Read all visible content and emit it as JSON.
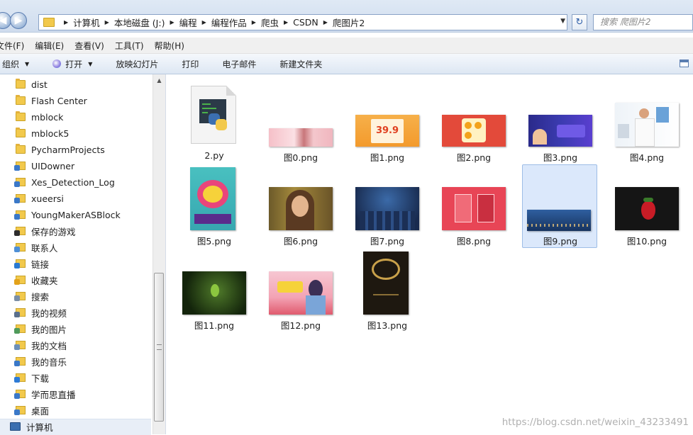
{
  "addressbar": {
    "breadcrumbs": [
      "计算机",
      "本地磁盘 (J:)",
      "编程",
      "编程作品",
      "爬虫",
      "CSDN",
      "爬图片2"
    ],
    "search_placeholder": "搜索 爬图片2"
  },
  "menubar": {
    "items": [
      "文件(F)",
      "编辑(E)",
      "查看(V)",
      "工具(T)",
      "帮助(H)"
    ]
  },
  "toolbar": {
    "organize": "组织",
    "open": "打开",
    "slideshow": "放映幻灯片",
    "print": "打印",
    "email": "电子邮件",
    "new_folder": "新建文件夹"
  },
  "navpane": {
    "items": [
      {
        "label": "dist",
        "icon": "folder-icon"
      },
      {
        "label": "Flash Center",
        "icon": "folder-icon"
      },
      {
        "label": "mblock",
        "icon": "folder-icon"
      },
      {
        "label": "mblock5",
        "icon": "folder-icon"
      },
      {
        "label": "PycharmProjects",
        "icon": "folder-icon"
      },
      {
        "label": "UIDowner",
        "icon": "special-folder-icon"
      },
      {
        "label": "Xes_Detection_Log",
        "icon": "special-folder-icon"
      },
      {
        "label": "xueersi",
        "icon": "special-folder-icon"
      },
      {
        "label": "YoungMakerASBlock",
        "icon": "special-folder-icon"
      },
      {
        "label": "保存的游戏",
        "icon": "saved-games-icon"
      },
      {
        "label": "联系人",
        "icon": "contacts-icon"
      },
      {
        "label": "链接",
        "icon": "links-icon"
      },
      {
        "label": "收藏夹",
        "icon": "favorites-icon"
      },
      {
        "label": "搜索",
        "icon": "searches-icon"
      },
      {
        "label": "我的视频",
        "icon": "videos-icon"
      },
      {
        "label": "我的图片",
        "icon": "pictures-icon"
      },
      {
        "label": "我的文档",
        "icon": "documents-icon"
      },
      {
        "label": "我的音乐",
        "icon": "music-icon"
      },
      {
        "label": "下载",
        "icon": "downloads-icon"
      },
      {
        "label": "学而思直播",
        "icon": "special-folder-icon"
      },
      {
        "label": "桌面",
        "icon": "desktop-icon"
      }
    ],
    "computer": "计算机"
  },
  "files": [
    {
      "name": "2.py"
    },
    {
      "name": "图0.png"
    },
    {
      "name": "图1.png"
    },
    {
      "name": "图2.png"
    },
    {
      "name": "图3.png"
    },
    {
      "name": "图4.png"
    },
    {
      "name": "图5.png"
    },
    {
      "name": "图6.png"
    },
    {
      "name": "图7.png"
    },
    {
      "name": "图8.png"
    },
    {
      "name": "图9.png"
    },
    {
      "name": "图10.png"
    },
    {
      "name": "图11.png"
    },
    {
      "name": "图12.png"
    },
    {
      "name": "图13.png"
    }
  ],
  "thumb_texts": {
    "img1_price": "39.9"
  },
  "watermark": "https://blog.csdn.net/weixin_43233491"
}
